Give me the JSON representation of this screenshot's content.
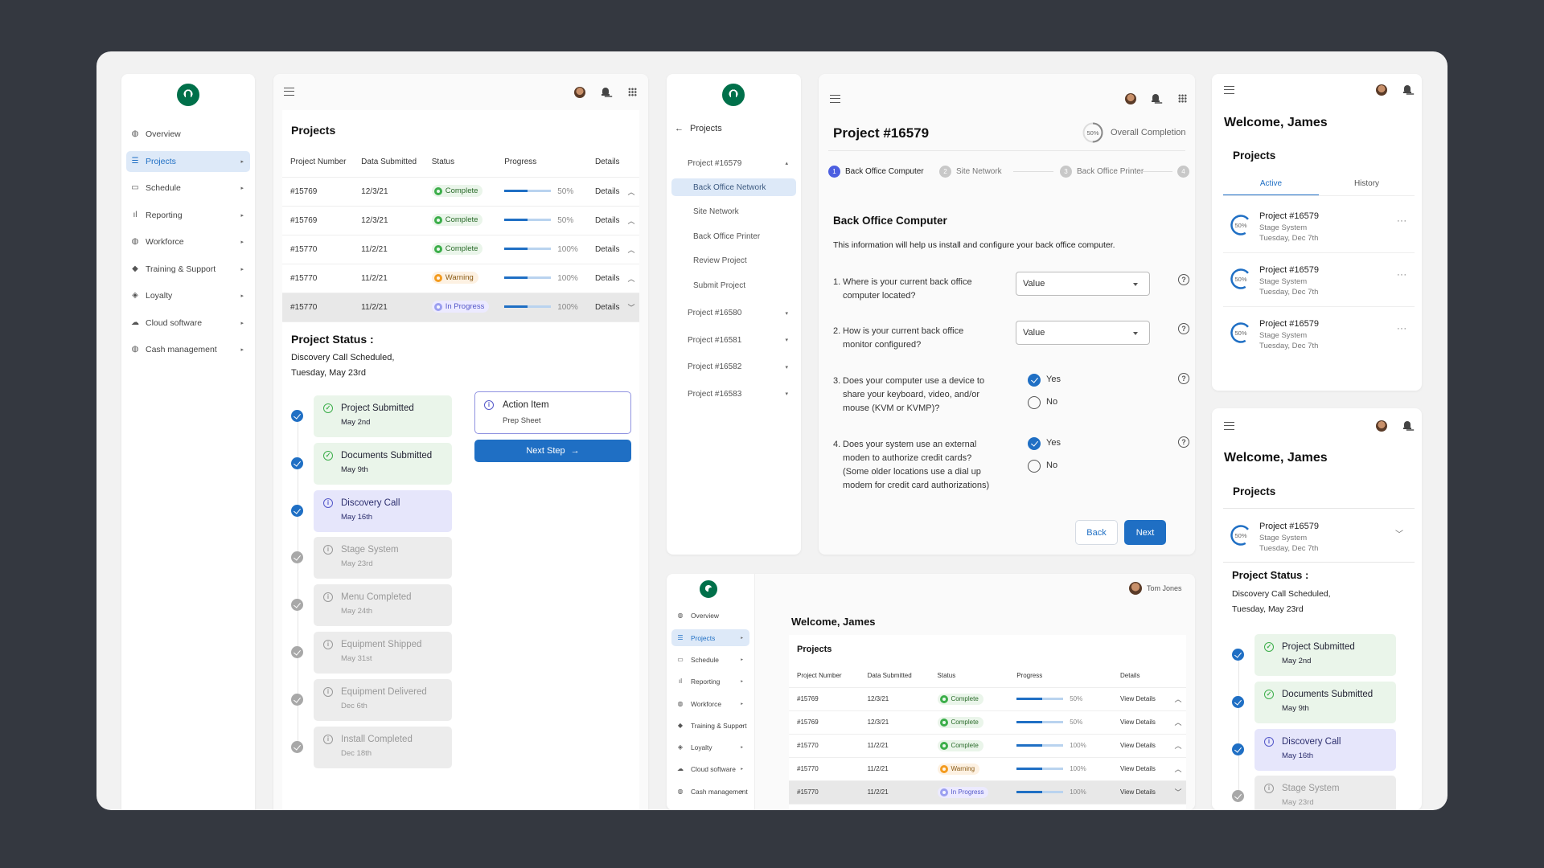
{
  "brand": {
    "logo": "starbucks-siren-logo",
    "accent": "#1f6fc4",
    "green": "#00704a"
  },
  "sidebar": {
    "items": [
      {
        "label": "Overview",
        "icon": "globe-icon",
        "active": false,
        "caret": false
      },
      {
        "label": "Projects",
        "icon": "list-icon",
        "active": true,
        "caret": true
      },
      {
        "label": "Schedule",
        "icon": "calendar-icon",
        "active": false,
        "caret": true
      },
      {
        "label": "Reporting",
        "icon": "bar-chart-icon",
        "active": false,
        "caret": true
      },
      {
        "label": "Workforce",
        "icon": "globe-icon",
        "active": false,
        "caret": true
      },
      {
        "label": "Training & Support",
        "icon": "graduation-cap-icon",
        "active": false,
        "caret": true
      },
      {
        "label": "Loyalty",
        "icon": "tag-icon",
        "active": false,
        "caret": true
      },
      {
        "label": "Cloud software",
        "icon": "cloud-icon",
        "active": false,
        "caret": true
      },
      {
        "label": "Cash management",
        "icon": "globe-icon",
        "active": false,
        "caret": true
      }
    ]
  },
  "projects_panel": {
    "title": "Projects",
    "columns": [
      "Project Number",
      "Data Submitted",
      "Status",
      "Progress",
      "Details"
    ],
    "rows": [
      {
        "number": "#15769",
        "date": "12/3/21",
        "status": "Complete",
        "status_type": "complete",
        "progress_pct": "50%",
        "progress_fill": 0.5,
        "details": "Details",
        "chevron": "up"
      },
      {
        "number": "#15769",
        "date": "12/3/21",
        "status": "Complete",
        "status_type": "complete",
        "progress_pct": "50%",
        "progress_fill": 0.5,
        "details": "Details",
        "chevron": "up"
      },
      {
        "number": "#15770",
        "date": "11/2/21",
        "status": "Complete",
        "status_type": "complete",
        "progress_pct": "100%",
        "progress_fill": 0.5,
        "details": "Details",
        "chevron": "up"
      },
      {
        "number": "#15770",
        "date": "11/2/21",
        "status": "Warning",
        "status_type": "warning",
        "progress_pct": "100%",
        "progress_fill": 0.5,
        "details": "Details",
        "chevron": "up"
      },
      {
        "number": "#15770",
        "date": "11/2/21",
        "status": "In Progress",
        "status_type": "progress",
        "progress_pct": "100%",
        "progress_fill": 0.5,
        "details": "Details",
        "chevron": "down",
        "selected": true
      }
    ],
    "status_heading": "Project Status :",
    "status_line1": "Discovery Call Scheduled,",
    "status_line2": "Tuesday, May  23rd",
    "steps": [
      {
        "title": "Project Submitted",
        "date": "May 2nd",
        "state": "done"
      },
      {
        "title": "Documents Submitted",
        "date": "May 9th",
        "state": "done"
      },
      {
        "title": "Discovery Call",
        "date": "May 16th",
        "state": "current"
      },
      {
        "title": "Stage System",
        "date": "May 23rd",
        "state": "future"
      },
      {
        "title": "Menu Completed",
        "date": "May 24th",
        "state": "future"
      },
      {
        "title": "Equipment Shipped",
        "date": "May 31st",
        "state": "future"
      },
      {
        "title": "Equipment Delivered",
        "date": "Dec 6th",
        "state": "future"
      },
      {
        "title": "Install Completed",
        "date": "Dec 18th",
        "state": "future"
      }
    ],
    "action_item": {
      "title": "Action Item",
      "subtitle": "Prep Sheet"
    },
    "next_step_label": "Next Step"
  },
  "project_nav": {
    "back_label": "Projects",
    "groups": [
      {
        "label": "Project #16579",
        "expanded": true,
        "children": [
          "Back Office Network",
          "Site Network",
          "Back Office Printer",
          "Review Project",
          "Submit Project"
        ],
        "active_child": 0
      },
      {
        "label": "Project #16580",
        "expanded": false
      },
      {
        "label": "Project #16581",
        "expanded": false
      },
      {
        "label": "Project #16582",
        "expanded": false
      },
      {
        "label": "Project #16583",
        "expanded": false
      }
    ]
  },
  "form_panel": {
    "title": "Project #16579",
    "completion_pct": "50%",
    "completion_fraction": 0.5,
    "completion_label": "Overall Completion",
    "stepper": [
      {
        "num": "1",
        "label": "Back Office Computer",
        "active": true
      },
      {
        "num": "2",
        "label": "Site Network",
        "active": false
      },
      {
        "num": "3",
        "label": "Back Office Printer",
        "active": false
      },
      {
        "num": "4",
        "label": "",
        "active": false
      }
    ],
    "section_title": "Back Office Computer",
    "section_desc": "This information will help us install and configure your back office computer.",
    "questions": [
      {
        "num": "1.",
        "lines": [
          "Where is your current back office",
          "computer located?"
        ],
        "type": "select",
        "value": "Value"
      },
      {
        "num": "2.",
        "lines": [
          "How is your current back office",
          "monitor configured?"
        ],
        "type": "select",
        "value": "Value"
      },
      {
        "num": "3.",
        "lines": [
          "Does your computer use a device to",
          "share your keyboard, video, and/or",
          "mouse (KVM or KVMP)?"
        ],
        "type": "radio",
        "options": [
          "Yes",
          "No"
        ],
        "selected": "Yes"
      },
      {
        "num": "4.",
        "lines": [
          "Does your system use an external",
          "moden to authorize credit cards?",
          "(Some older locations use a dial up",
          "modem for credit card authorizations)"
        ],
        "type": "radio",
        "options": [
          "Yes",
          "No"
        ],
        "selected": "Yes"
      }
    ],
    "back_label": "Back",
    "next_label": "Next"
  },
  "mobile_list": {
    "welcome": "Welcome, James",
    "projects_title": "Projects",
    "tabs": [
      "Active",
      "History"
    ],
    "active_tab": 0,
    "items": [
      {
        "pct": "50%",
        "title": "Project #16579",
        "stage": "Stage System",
        "date": "Tuesday, Dec 7th"
      },
      {
        "pct": "50%",
        "title": "Project #16579",
        "stage": "Stage System",
        "date": "Tuesday, Dec 7th"
      },
      {
        "pct": "50%",
        "title": "Project #16579",
        "stage": "Stage System",
        "date": "Tuesday, Dec 7th"
      }
    ]
  },
  "mobile_detail": {
    "welcome": "Welcome, James",
    "projects_title": "Projects",
    "item": {
      "pct": "50%",
      "title": "Project #16579",
      "stage": "Stage System",
      "date": "Tuesday, Dec 7th"
    },
    "status_heading": "Project Status :",
    "status_line1": "Discovery Call Scheduled,",
    "status_line2": "Tuesday, May  23rd",
    "steps": [
      {
        "title": "Project Submitted",
        "date": "May 2nd",
        "state": "done"
      },
      {
        "title": "Documents Submitted",
        "date": "May 9th",
        "state": "done"
      },
      {
        "title": "Discovery Call",
        "date": "May 16th",
        "state": "current"
      },
      {
        "title": "Stage System",
        "date": "May 23rd",
        "state": "future"
      }
    ]
  },
  "desktop_small": {
    "user_name": "Tom Jones",
    "welcome": "Welcome, James",
    "projects_title": "Projects",
    "columns": [
      "Project Number",
      "Data Submitted",
      "Status",
      "Progress",
      "Details"
    ],
    "rows": [
      {
        "number": "#15769",
        "date": "12/3/21",
        "status": "Complete",
        "status_type": "complete",
        "progress_pct": "50%",
        "progress_fill": 0.55,
        "details": "View Details",
        "chevron": "up"
      },
      {
        "number": "#15769",
        "date": "12/3/21",
        "status": "Complete",
        "status_type": "complete",
        "progress_pct": "50%",
        "progress_fill": 0.55,
        "details": "View Details",
        "chevron": "up"
      },
      {
        "number": "#15770",
        "date": "11/2/21",
        "status": "Complete",
        "status_type": "complete",
        "progress_pct": "100%",
        "progress_fill": 0.55,
        "details": "View Details",
        "chevron": "up"
      },
      {
        "number": "#15770",
        "date": "11/2/21",
        "status": "Warning",
        "status_type": "warning",
        "progress_pct": "100%",
        "progress_fill": 0.55,
        "details": "View Details",
        "chevron": "up"
      },
      {
        "number": "#15770",
        "date": "11/2/21",
        "status": "In Progress",
        "status_type": "progress",
        "progress_pct": "100%",
        "progress_fill": 0.55,
        "details": "View Details",
        "chevron": "down",
        "selected": true
      }
    ]
  }
}
